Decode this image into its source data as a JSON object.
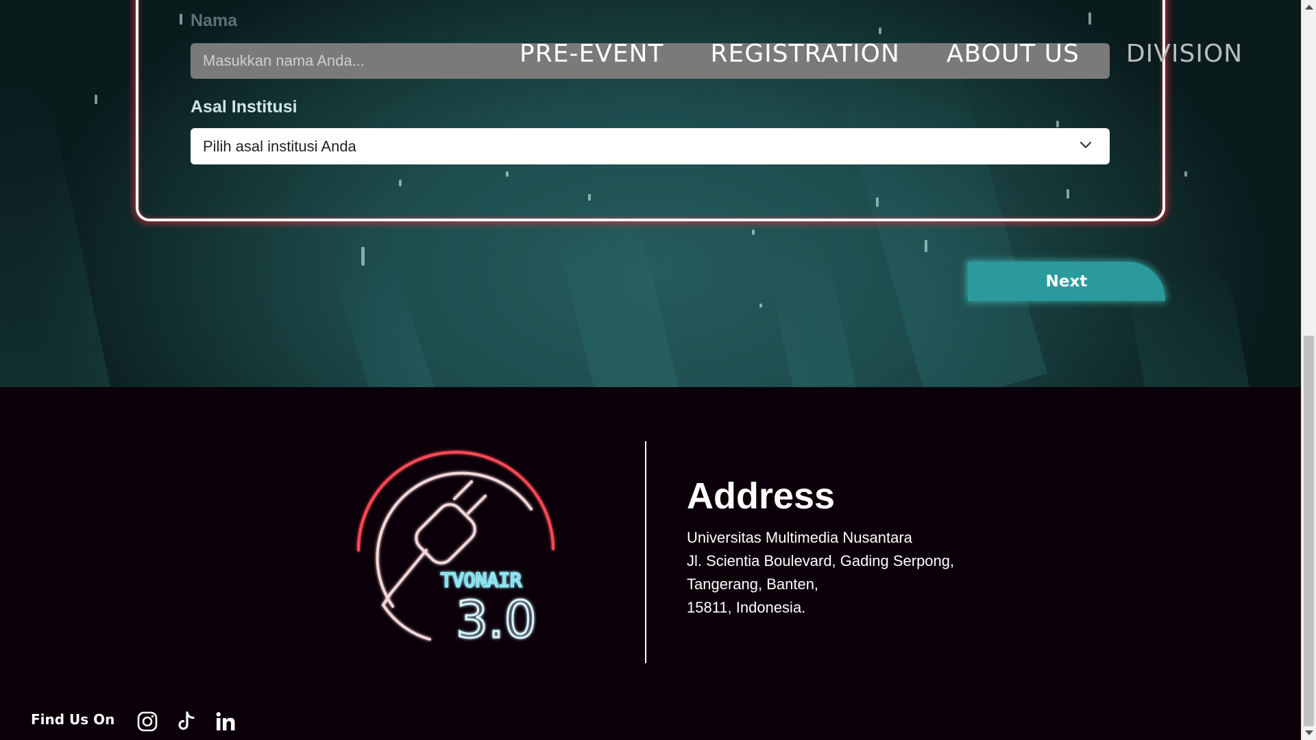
{
  "form": {
    "name_label": "Nama",
    "name_placeholder": "Masukkan nama Anda...",
    "institution_label": "Asal Institusi",
    "institution_value": "Pilih asal institusi Anda",
    "next_label": "Next"
  },
  "nav": {
    "items": [
      {
        "label": "PRE-EVENT"
      },
      {
        "label": "REGISTRATION"
      },
      {
        "label": "ABOUT US"
      },
      {
        "label": "DIVISION"
      }
    ]
  },
  "footer": {
    "logo": {
      "line1": "TVONAIR",
      "line2": "3.0"
    },
    "address_title": "Address",
    "address_lines": [
      "Universitas Multimedia Nusantara",
      "Jl. Scientia Boulevard, Gading Serpong,",
      "Tangerang, Banten,",
      "15811, Indonesia."
    ],
    "find_us": "Find Us On",
    "social_icons": [
      "instagram-icon",
      "tiktok-icon",
      "linkedin-icon"
    ]
  },
  "colors": {
    "accent_teal": "#2b9a9c",
    "glow_red": "#ff2a3c",
    "footer_bg": "#0b0009"
  }
}
